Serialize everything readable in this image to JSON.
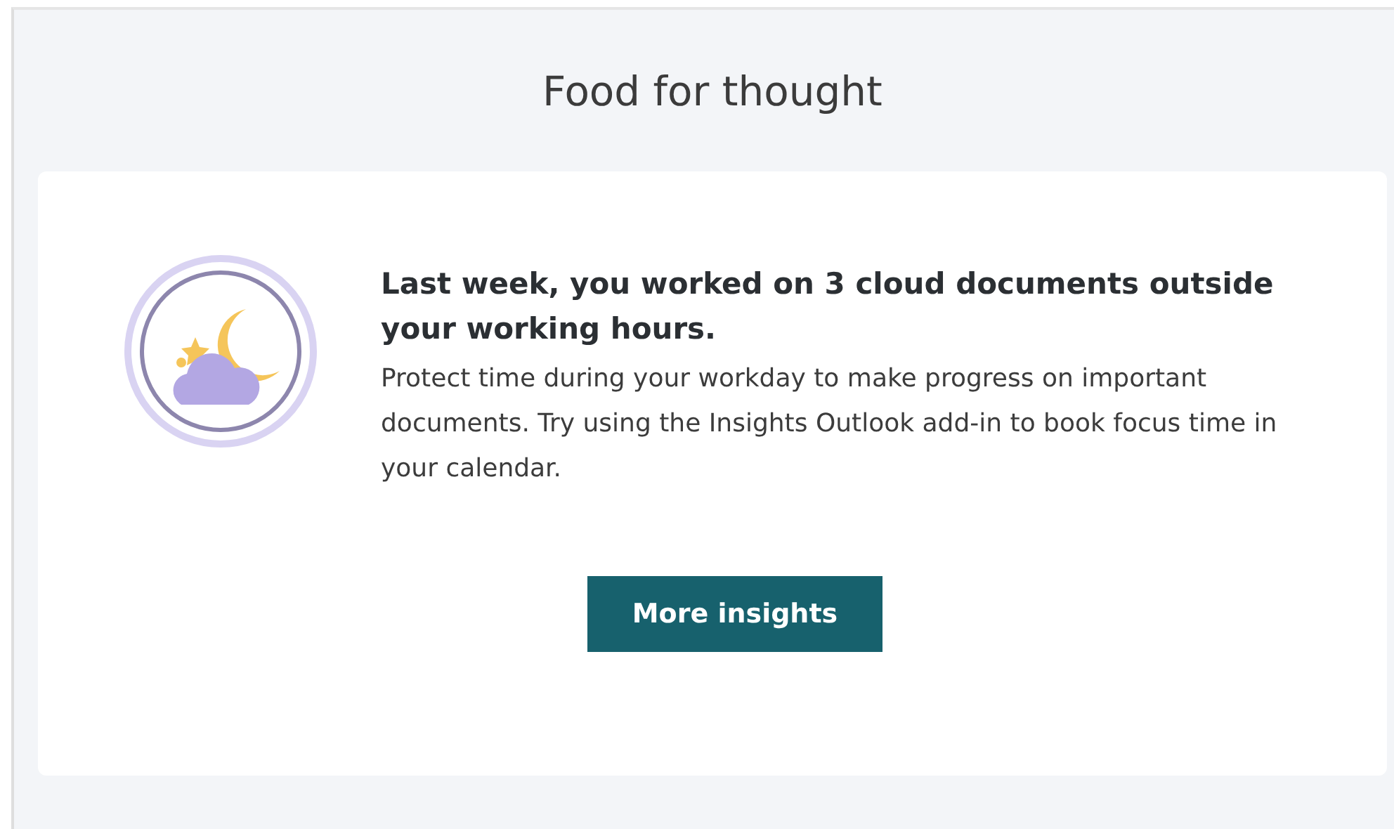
{
  "panel": {
    "title": "Food for thought"
  },
  "card": {
    "heading": "Last week, you worked on 3 cloud documents outside your working hours.",
    "body": "Protect time during your workday to make progress on important documents. Try using the Insights Outlook add-in to book focus time in your calendar.",
    "button": "More insights"
  }
}
